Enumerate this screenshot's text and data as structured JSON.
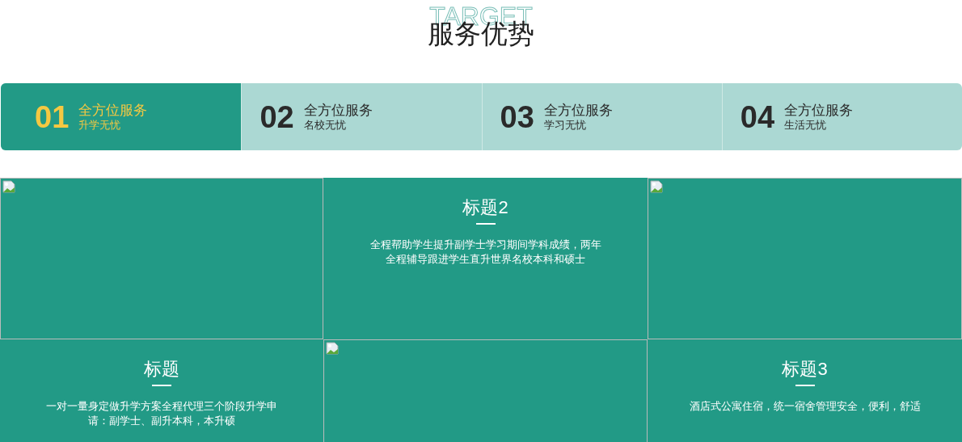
{
  "header": {
    "background_word": "TARGET",
    "title": "服务优势"
  },
  "tabs": [
    {
      "number": "01",
      "title": "全方位服务",
      "subtitle": "升学无忧",
      "selected": true
    },
    {
      "number": "02",
      "title": "全方位服务",
      "subtitle": "名校无忧",
      "selected": false
    },
    {
      "number": "03",
      "title": "全方位服务",
      "subtitle": "学习无忧",
      "selected": false
    },
    {
      "number": "04",
      "title": "全方位服务",
      "subtitle": "生活无忧",
      "selected": false
    }
  ],
  "cells": [
    {
      "kind": "image"
    },
    {
      "kind": "text",
      "title": "标题2",
      "body": "全程帮助学生提升副学士学习期间学科成绩，两年全程辅导跟进学生直升世界名校本科和硕士"
    },
    {
      "kind": "image"
    },
    {
      "kind": "text",
      "title": "标题",
      "body": "一对一量身定做升学方案全程代理三个阶段升学申请：副学士、副升本科，本升硕"
    },
    {
      "kind": "image"
    },
    {
      "kind": "text",
      "title": "标题3",
      "body": "酒店式公寓住宿，统一宿舍管理安全，便利，舒适"
    }
  ]
}
